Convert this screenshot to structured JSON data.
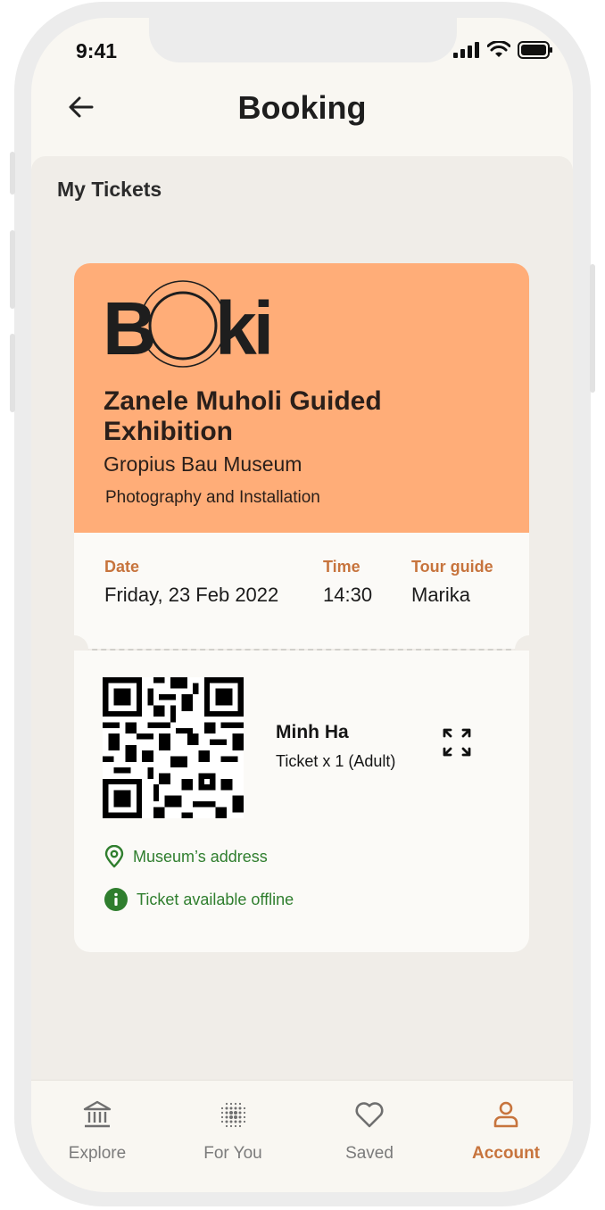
{
  "status": {
    "time": "9:41"
  },
  "header": {
    "title": "Booking"
  },
  "section": {
    "title": "My Tickets"
  },
  "ticket": {
    "logo_text": "BOKI",
    "event_name": "Zanele Muholi Guided Exhibition",
    "venue": "Gropius Bau Museum",
    "category": "Photography and Installation",
    "date_label": "Date",
    "date_value": "Friday, 23 Feb 2022",
    "time_label": "Time",
    "time_value": "14:30",
    "guide_label": "Tour guide",
    "guide_value": "Marika",
    "holder_name": "Minh Ha",
    "ticket_count": "Ticket x 1 (Adult)",
    "address_link": "Museum’s address",
    "offline_note": "Ticket available offline"
  },
  "tabs": [
    {
      "label": "Explore",
      "icon": "museum-icon"
    },
    {
      "label": "For You",
      "icon": "dots-grid-icon"
    },
    {
      "label": "Saved",
      "icon": "heart-icon"
    },
    {
      "label": "Account",
      "icon": "user-icon",
      "active": true
    }
  ],
  "colors": {
    "accent": "#c7743d",
    "ticket_header": "#ffad78",
    "success": "#2f7e2e"
  }
}
